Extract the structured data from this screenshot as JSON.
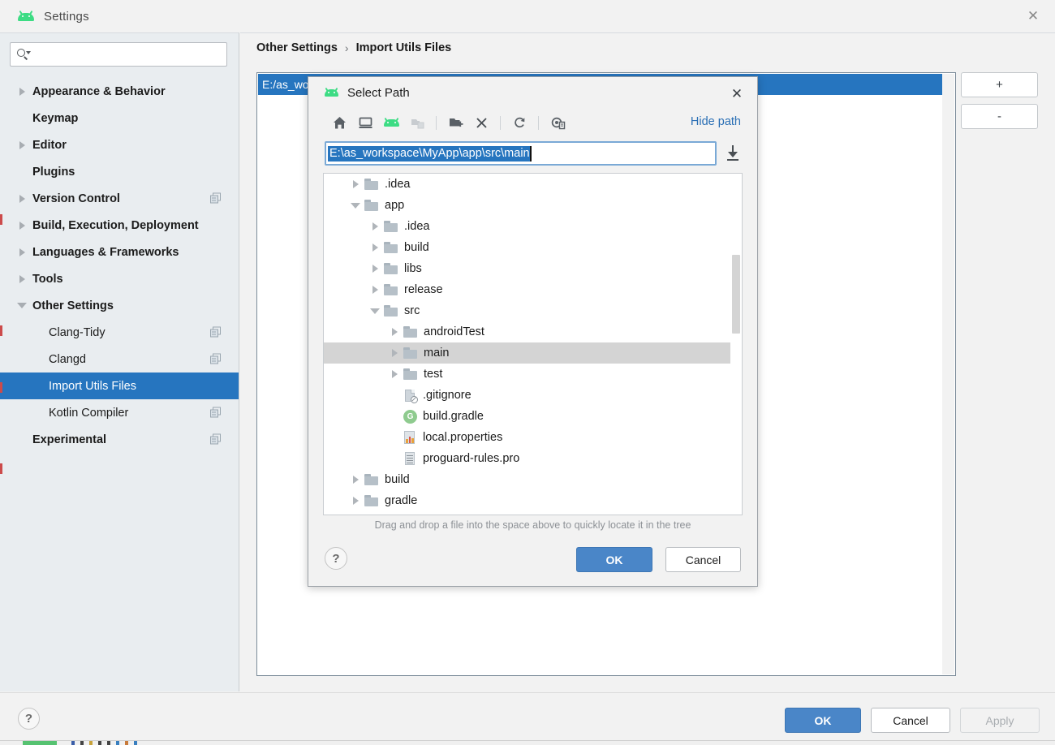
{
  "window": {
    "title": "Settings",
    "close_icon": "close-icon",
    "app_icon": "android-icon"
  },
  "sidebar": {
    "search": {
      "value": "",
      "placeholder": "",
      "icon": "search-icon"
    },
    "items": [
      {
        "label": "Appearance & Behavior",
        "level": 0,
        "arrow": "right",
        "bold": true,
        "copy": false,
        "selected": false
      },
      {
        "label": "Keymap",
        "level": 0,
        "arrow": "none",
        "bold": true,
        "copy": false,
        "selected": false
      },
      {
        "label": "Editor",
        "level": 0,
        "arrow": "right",
        "bold": true,
        "copy": false,
        "selected": false
      },
      {
        "label": "Plugins",
        "level": 0,
        "arrow": "none",
        "bold": true,
        "copy": false,
        "selected": false
      },
      {
        "label": "Version Control",
        "level": 0,
        "arrow": "right",
        "bold": true,
        "copy": true,
        "selected": false
      },
      {
        "label": "Build, Execution, Deployment",
        "level": 0,
        "arrow": "right",
        "bold": true,
        "copy": false,
        "selected": false
      },
      {
        "label": "Languages & Frameworks",
        "level": 0,
        "arrow": "right",
        "bold": true,
        "copy": false,
        "selected": false
      },
      {
        "label": "Tools",
        "level": 0,
        "arrow": "right",
        "bold": true,
        "copy": false,
        "selected": false
      },
      {
        "label": "Other Settings",
        "level": 0,
        "arrow": "down",
        "bold": true,
        "copy": false,
        "selected": false
      },
      {
        "label": "Clang-Tidy",
        "level": 1,
        "arrow": "none",
        "bold": false,
        "copy": true,
        "selected": false
      },
      {
        "label": "Clangd",
        "level": 1,
        "arrow": "none",
        "bold": false,
        "copy": true,
        "selected": false
      },
      {
        "label": "Import Utils Files",
        "level": 1,
        "arrow": "none",
        "bold": false,
        "copy": false,
        "selected": true
      },
      {
        "label": "Kotlin Compiler",
        "level": 1,
        "arrow": "none",
        "bold": false,
        "copy": true,
        "selected": false
      },
      {
        "label": "Experimental",
        "level": 0,
        "arrow": "none",
        "bold": true,
        "copy": true,
        "selected": false
      }
    ]
  },
  "main": {
    "breadcrumb": {
      "parent": "Other Settings",
      "separator": "›",
      "current": "Import Utils Files"
    },
    "list": {
      "selected_row": "E:/as_wo"
    },
    "side_buttons": [
      {
        "label": "+",
        "name": "add-path-button"
      },
      {
        "label": "-",
        "name": "remove-path-button"
      }
    ]
  },
  "footer": {
    "help": "?",
    "ok": "OK",
    "cancel": "Cancel",
    "apply": "Apply",
    "apply_disabled": true
  },
  "dialog": {
    "title": "Select Path",
    "close_icon": "close-icon",
    "toolbar": [
      {
        "name": "home-icon",
        "enabled": true
      },
      {
        "name": "desktop-icon",
        "enabled": true
      },
      {
        "name": "android-icon",
        "enabled": true
      },
      {
        "name": "project-folder-icon",
        "enabled": false
      },
      {
        "name": "new-folder-icon",
        "enabled": true
      },
      {
        "name": "delete-icon",
        "enabled": true
      },
      {
        "name": "refresh-icon",
        "enabled": true
      },
      {
        "name": "show-hidden-icon",
        "enabled": true
      }
    ],
    "hide_path_label": "Hide path",
    "path_field": {
      "value": "E:\\as_workspace\\MyApp\\app\\src\\main",
      "selected": true
    },
    "download_icon": "download-icon",
    "tree": [
      {
        "label": ".idea",
        "indent": 1,
        "arrow": "right",
        "icon": "folder",
        "selected": false
      },
      {
        "label": "app",
        "indent": 1,
        "arrow": "down",
        "icon": "folder",
        "selected": false
      },
      {
        "label": ".idea",
        "indent": 2,
        "arrow": "right",
        "icon": "folder",
        "selected": false
      },
      {
        "label": "build",
        "indent": 2,
        "arrow": "right",
        "icon": "folder",
        "selected": false
      },
      {
        "label": "libs",
        "indent": 2,
        "arrow": "right",
        "icon": "folder",
        "selected": false
      },
      {
        "label": "release",
        "indent": 2,
        "arrow": "right",
        "icon": "folder",
        "selected": false
      },
      {
        "label": "src",
        "indent": 2,
        "arrow": "down",
        "icon": "folder",
        "selected": false
      },
      {
        "label": "androidTest",
        "indent": 3,
        "arrow": "right",
        "icon": "folder",
        "selected": false
      },
      {
        "label": "main",
        "indent": 3,
        "arrow": "right",
        "icon": "folder",
        "selected": true
      },
      {
        "label": "test",
        "indent": 3,
        "arrow": "right",
        "icon": "folder",
        "selected": false
      },
      {
        "label": ".gitignore",
        "indent": 3,
        "arrow": "none",
        "icon": "gitignore",
        "selected": false
      },
      {
        "label": "build.gradle",
        "indent": 3,
        "arrow": "none",
        "icon": "gradle",
        "selected": false
      },
      {
        "label": "local.properties",
        "indent": 3,
        "arrow": "none",
        "icon": "properties",
        "selected": false
      },
      {
        "label": "proguard-rules.pro",
        "indent": 3,
        "arrow": "none",
        "icon": "pro",
        "selected": false
      },
      {
        "label": "build",
        "indent": 1,
        "arrow": "right",
        "icon": "folder",
        "selected": false
      },
      {
        "label": "gradle",
        "indent": 1,
        "arrow": "right",
        "icon": "folder",
        "selected": false
      }
    ],
    "drag_hint": "Drag and drop a file into the space above to quickly locate it in the tree",
    "help": "?",
    "ok": "OK",
    "cancel": "Cancel"
  },
  "colors": {
    "accent_blue": "#2675bf",
    "button_blue": "#4a86c8",
    "android_green": "#3ddc84",
    "link_blue": "#2a6fb5",
    "sidebar_bg": "#e9edf0",
    "panel_bg": "#f2f2f2"
  }
}
